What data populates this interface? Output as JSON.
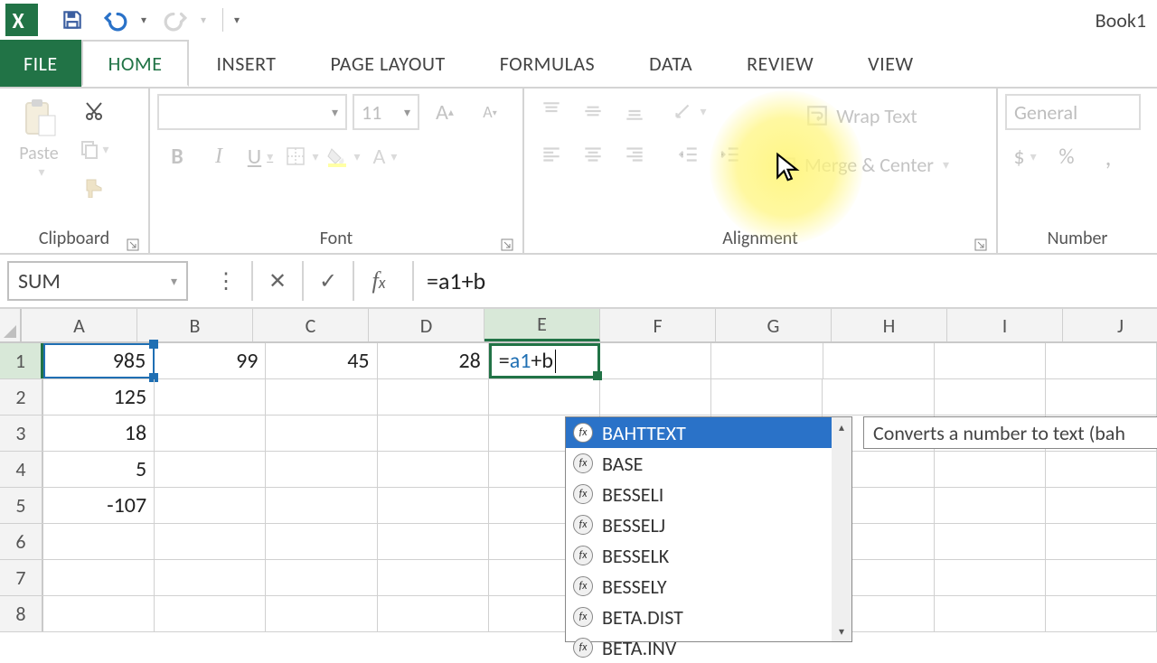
{
  "title": "Book1",
  "tabs": {
    "file": "FILE",
    "home": "HOME",
    "insert": "INSERT",
    "pagelayout": "PAGE LAYOUT",
    "formulas": "FORMULAS",
    "data": "DATA",
    "review": "REVIEW",
    "view": "VIEW"
  },
  "ribbon": {
    "clipboard": {
      "label": "Clipboard",
      "paste": "Paste"
    },
    "font": {
      "label": "Font",
      "name": "",
      "size": "11",
      "bold": "B",
      "italic": "I",
      "underline": "U"
    },
    "alignment": {
      "label": "Alignment",
      "wrap": "Wrap Text",
      "merge": "Merge & Center"
    },
    "number": {
      "label": "Number",
      "format": "General",
      "dollar": "$",
      "percent": "%"
    }
  },
  "fbar": {
    "namebox": "SUM",
    "formula": "=a1+b"
  },
  "grid": {
    "columns": [
      "A",
      "B",
      "C",
      "D",
      "E",
      "F",
      "G",
      "H",
      "I",
      "J"
    ],
    "activeCol": "E",
    "activeRow": "1",
    "rows": [
      "1",
      "2",
      "3",
      "4",
      "5",
      "6",
      "7",
      "8"
    ],
    "data": {
      "1": {
        "A": "985",
        "B": "99",
        "C": "45",
        "D": "28"
      },
      "2": {
        "A": "125"
      },
      "3": {
        "A": "18"
      },
      "4": {
        "A": "5"
      },
      "5": {
        "A": "-107"
      }
    },
    "editCell": {
      "prefix": "=",
      "ref": "a1",
      "suffix": "+b"
    }
  },
  "autocomplete": {
    "items": [
      "BAHTTEXT",
      "BASE",
      "BESSELI",
      "BESSELJ",
      "BESSELK",
      "BESSELY",
      "BETA.DIST",
      "BETA.INV"
    ],
    "selected": 0,
    "tooltip": "Converts a number to text (bah"
  }
}
